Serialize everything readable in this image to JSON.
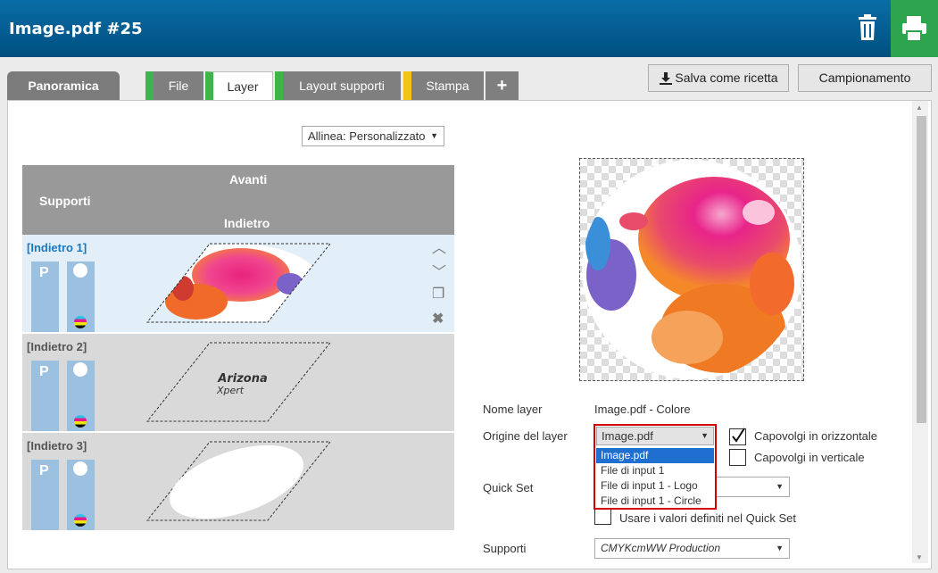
{
  "window": {
    "title": "Image.pdf #25"
  },
  "toolbar": {
    "delete_icon": "trash-icon",
    "print_icon": "printer-icon",
    "print_color": "#2fa44f"
  },
  "tabs": [
    {
      "label": "Panoramica",
      "color": "#7b7b7b"
    },
    {
      "label": "File",
      "status": "#3db54a"
    },
    {
      "label": "Layer",
      "status": "#3db54a",
      "active": true
    },
    {
      "label": "Layout supporti",
      "status": "#3db54a"
    },
    {
      "label": "Stampa",
      "status": "#f0c419"
    },
    {
      "label": "+"
    }
  ],
  "actions": {
    "save_recipe": "Salva come ricetta",
    "sampling": "Campionamento"
  },
  "align": {
    "value": "Allinea: Personalizzato"
  },
  "layers_header": {
    "front": "Avanti",
    "media": "Supporti",
    "back": "Indietro"
  },
  "layers": [
    {
      "title": "[Indietro 1]",
      "p_label": "P",
      "selected": true,
      "content": "image"
    },
    {
      "title": "[Indietro 2]",
      "p_label": "P",
      "content_text_1": "Arizona",
      "content_text_2": "Xpert"
    },
    {
      "title": "[Indietro 3]",
      "p_label": "P",
      "content": "ellipse"
    }
  ],
  "properties": {
    "layer_name_label": "Nome layer",
    "layer_name_value": "Image.pdf - Colore",
    "origin_label": "Origine del layer",
    "origin_value": "Image.pdf",
    "origin_options": [
      "Image.pdf",
      "File di input 1",
      "File di input 1 - Logo",
      "File di input 1 - Circle"
    ],
    "flip_h_label": "Capovolgi in orizzontale",
    "flip_h_checked": true,
    "flip_v_label": "Capovolgi in verticale",
    "flip_v_checked": false,
    "quickset_label": "Quick Set",
    "quickset_value": "",
    "use_quickset_label": "Usare i valori definiti nel Quick Set",
    "media_label": "Supporti",
    "media_value": "CMYKcmWW Production"
  }
}
